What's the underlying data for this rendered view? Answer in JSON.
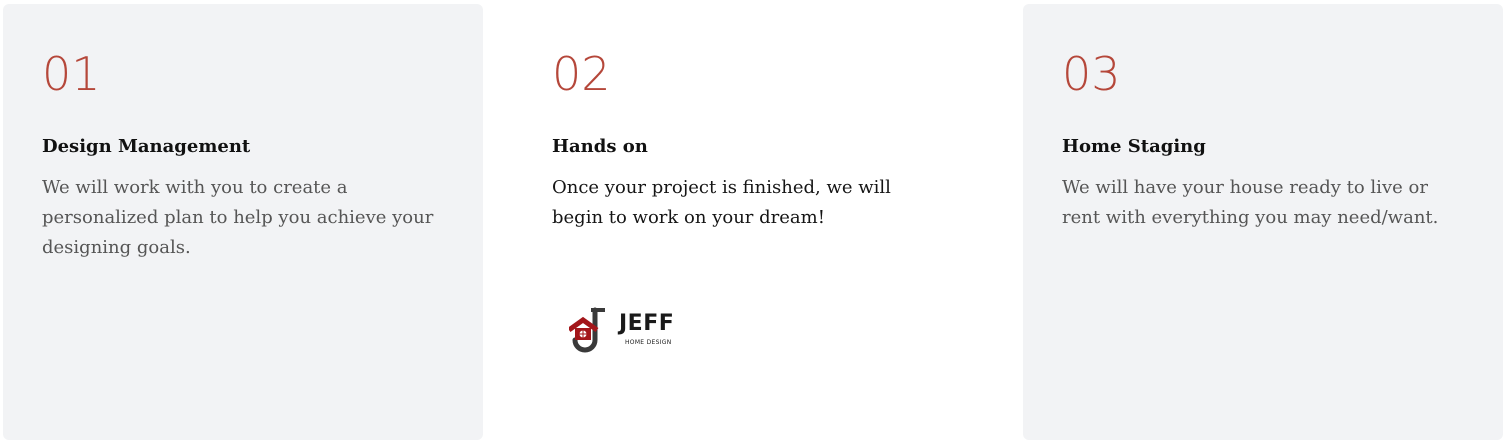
{
  "steps": [
    {
      "number": "01",
      "title": "Design Management",
      "description": "We will work with you to create a personalized plan to help you achieve your designing goals."
    },
    {
      "number": "02",
      "title": "Hands on",
      "description": "Once your project is finished, we will begin to work on your dream!"
    },
    {
      "number": "03",
      "title": "Home Staging",
      "description": "We will have your house ready to live or rent with everything you may need/want."
    }
  ],
  "logo": {
    "name": "JEFF",
    "tagline": "HOME DESIGN"
  },
  "colors": {
    "accent": "#b5473a",
    "card_background": "#f2f3f5",
    "logo_red": "#a3161a"
  }
}
